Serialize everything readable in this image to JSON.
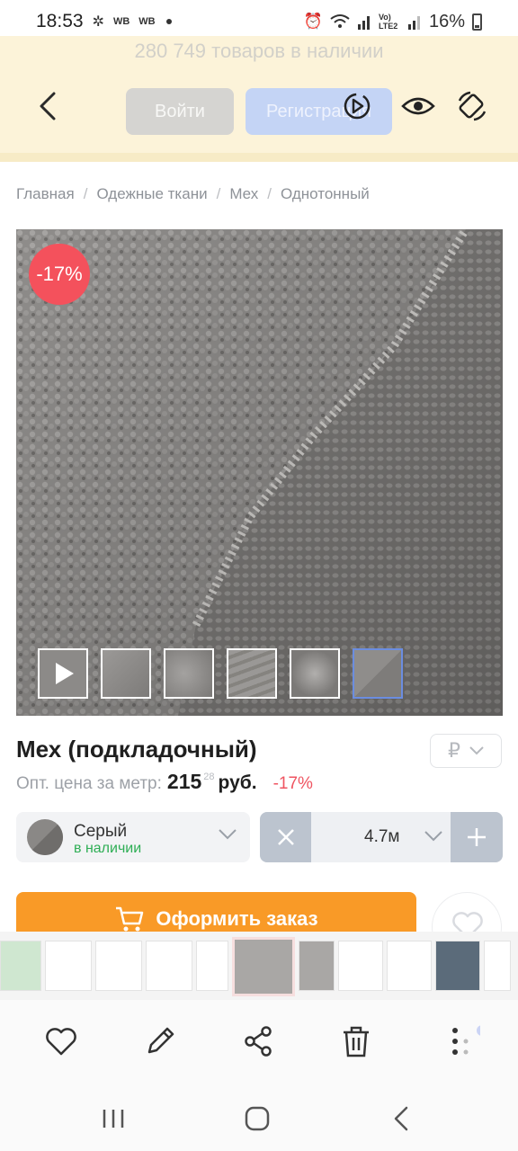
{
  "status_bar": {
    "time": "18:53",
    "app_badge_1": "WB",
    "app_badge_2": "WB",
    "network": "Vo) LTE2",
    "battery": "16%"
  },
  "header": {
    "stock_count": "280 749 товаров в наличии",
    "login_label": "Войти",
    "register_label": "Регистрация"
  },
  "breadcrumb": [
    "Главная",
    "Одежные ткани",
    "Мех",
    "Однотонный"
  ],
  "product": {
    "discount_badge": "-17%",
    "title": "Мех (подкладочный)",
    "currency": "₽",
    "price_label": "Опт. цена за метр:",
    "price_main": "215",
    "price_cents": "28",
    "price_unit": "руб.",
    "price_discount": "-17%",
    "thumbnail_count": 6
  },
  "color_select": {
    "name": "Серый",
    "availability": "в наличии"
  },
  "quantity": {
    "value": "4.7м"
  },
  "order_button": {
    "label": "Оформить заказ"
  },
  "colors": {
    "accent_orange": "#f99a27",
    "discount_red": "#f4515c",
    "in_stock_green": "#2eae55",
    "header_band": "#fcf3d9"
  }
}
